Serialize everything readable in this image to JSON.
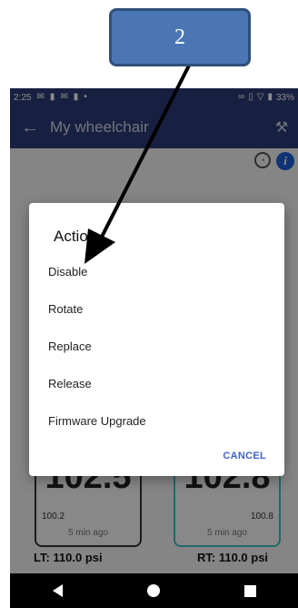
{
  "callout": {
    "step": "2"
  },
  "status_bar": {
    "time": "2:25",
    "battery": "33%",
    "left_icons": [
      "message-icon",
      "person-icon",
      "message-icon",
      "person-icon",
      "dot-icon"
    ],
    "right_icons": [
      "link-icon",
      "vibrate-icon",
      "wifi-icon",
      "battery-icon"
    ]
  },
  "app_bar": {
    "title": "My wheelchair",
    "back_icon": "arrow-left-icon",
    "settings_icon": "wrench-icon"
  },
  "dialog": {
    "title": "Action",
    "items": [
      {
        "label": "Disable"
      },
      {
        "label": "Rotate"
      },
      {
        "label": "Replace"
      },
      {
        "label": "Release"
      },
      {
        "label": "Firmware Upgrade"
      }
    ],
    "cancel": "CANCEL"
  },
  "tires": {
    "left": {
      "big": "102.5",
      "small": "100.2",
      "time": "5 min ago",
      "pressure": "LT: 110.0 psi"
    },
    "right": {
      "big": "102.8",
      "small": "100.8",
      "time": "5 min ago",
      "pressure": "RT: 110.0 psi"
    }
  },
  "colors": {
    "app_bar": "#2d3b77",
    "accent": "#3e63c7",
    "callout": "#4a77b4",
    "right_tire": "#3bbdc5"
  }
}
